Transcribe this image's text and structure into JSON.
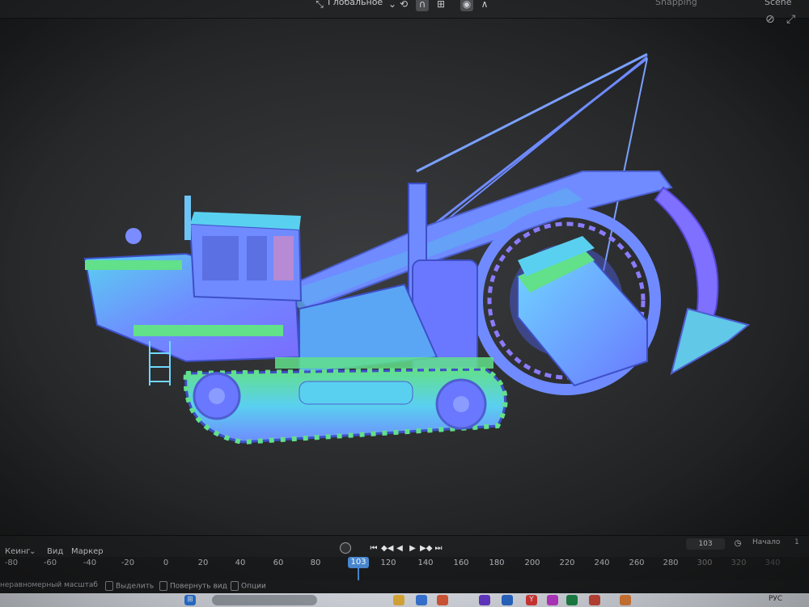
{
  "header": {
    "orientation_label": "Глобальное",
    "scene_label": "Scene",
    "snapping_label": "Snapping"
  },
  "icons": {
    "move_gizmo": "move-arrows-icon",
    "snap": "magnet-icon",
    "proportional": "circle-dot-icon",
    "view_gizmo": "view-gizmo-icon"
  },
  "timeline": {
    "menus": [
      "Кеинг",
      "Вид",
      "Маркер"
    ],
    "current_frame_field": "103",
    "start_label": "Начало",
    "start_value": "1",
    "current_frame": "103",
    "ticks": [
      "-80",
      "-60",
      "-40",
      "-20",
      "0",
      "20",
      "40",
      "60",
      "80",
      "120",
      "140",
      "160",
      "180",
      "200",
      "220",
      "240",
      "260",
      "280",
      "300",
      "320",
      "340"
    ]
  },
  "status_bar": {
    "items": [
      "неравномерный масштаб",
      "Выделить",
      "Повернуть вид",
      "Опции"
    ]
  },
  "taskbar": {
    "language": "РУС",
    "tray_letter": "Y"
  },
  "colors": {
    "model_blue": "#6f8bff",
    "model_cyan": "#5ad0f0",
    "model_green": "#62e08a",
    "model_pink": "#f08ab0",
    "accent_frame": "#4a8bd6"
  }
}
